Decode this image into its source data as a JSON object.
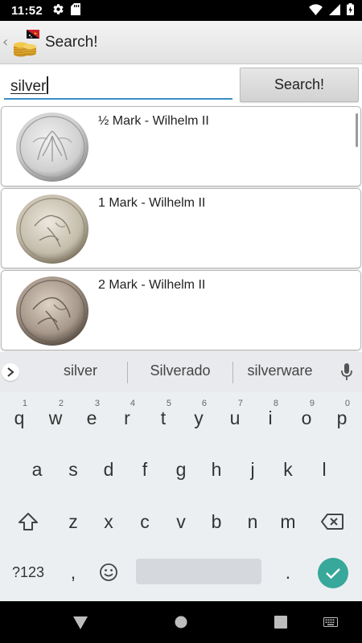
{
  "status_bar": {
    "time": "11:52",
    "left_icons": [
      "settings-icon",
      "sd-card-icon"
    ],
    "right_icons": [
      "wifi-icon",
      "signal-icon",
      "battery-icon"
    ]
  },
  "action_bar": {
    "title": "Search!",
    "back_glyph": "‹"
  },
  "search": {
    "query": "silver",
    "button_label": "Search!"
  },
  "results": [
    {
      "title": "½ Mark - Wilhelm II",
      "coin_tone": "#cfcfcf"
    },
    {
      "title": "1 Mark - Wilhelm II",
      "coin_tone": "#c7bfae"
    },
    {
      "title": "2 Mark - Wilhelm II",
      "coin_tone": "#a8998a"
    }
  ],
  "keyboard": {
    "suggestions": [
      "silver",
      "Silverado",
      "silverware"
    ],
    "row1": [
      "q",
      "w",
      "e",
      "r",
      "t",
      "y",
      "u",
      "i",
      "o",
      "p"
    ],
    "row1_hints": [
      "1",
      "2",
      "3",
      "4",
      "5",
      "6",
      "7",
      "8",
      "9",
      "0"
    ],
    "row2": [
      "a",
      "s",
      "d",
      "f",
      "g",
      "h",
      "j",
      "k",
      "l"
    ],
    "row3": [
      "z",
      "x",
      "c",
      "v",
      "b",
      "n",
      "m"
    ],
    "symbols_label": "?123",
    "comma": ",",
    "period": ".",
    "accent_color": "#37a89a"
  },
  "nav_bar": {
    "buttons": [
      "back-icon",
      "home-icon",
      "recents-icon",
      "keyboard-switch-icon"
    ]
  }
}
